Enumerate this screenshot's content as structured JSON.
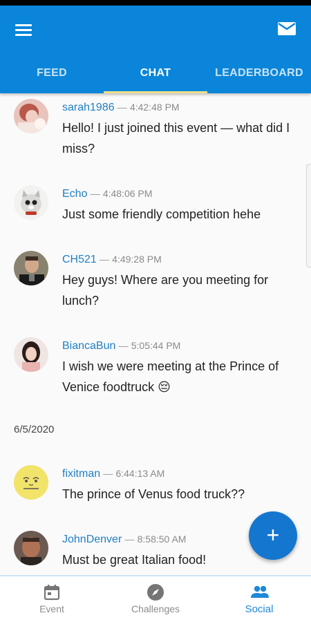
{
  "header": {
    "menu_icon": "menu-icon",
    "mail_icon": "mail-icon",
    "tabs": [
      {
        "label": "FEED",
        "active": false
      },
      {
        "label": "CHAT",
        "active": true
      },
      {
        "label": "LEADERBOARD",
        "active": false
      }
    ]
  },
  "colors": {
    "app_bar": "#0a85d9",
    "tab_indicator": "#f2df8a",
    "username": "#1f7fc4",
    "fab": "#1576cf",
    "active_nav": "#1e88d8"
  },
  "messages": [
    {
      "user": "sarah1986",
      "time": "4:42:48 PM",
      "text": "Hello! I just joined this event — what did I miss?",
      "avatar_icon": "user-photo-avatar"
    },
    {
      "user": "Echo",
      "time": "4:48:06 PM",
      "text": "Just some friendly competition hehe",
      "avatar_icon": "cat-photo-avatar"
    },
    {
      "user": "CH521",
      "time": "4:49:28 PM",
      "text": "Hey guys! Where are you meeting for lunch?",
      "avatar_icon": "user-photo-avatar"
    },
    {
      "user": "BiancaBun",
      "time": "5:05:44 PM",
      "text": "I wish we were meeting at the Prince of Venice foodtruck 😔",
      "avatar_icon": "user-photo-avatar"
    },
    {
      "user": "fixitman",
      "time": "6:44:13 AM",
      "text": "The prince of Venus food truck??",
      "avatar_icon": "drawn-face-avatar"
    },
    {
      "user": "JohnDenver",
      "time": "8:58:50 AM",
      "text": "Must be great Italian food!",
      "avatar_icon": "user-photo-avatar"
    }
  ],
  "date_divider": "6/5/2020",
  "separator": "—",
  "fab": {
    "label": "+",
    "icon": "plus-icon"
  },
  "bottom_nav": [
    {
      "label": "Event",
      "icon": "calendar-icon",
      "active": false
    },
    {
      "label": "Challenges",
      "icon": "compass-icon",
      "active": false
    },
    {
      "label": "Social",
      "icon": "people-icon",
      "active": true
    }
  ]
}
